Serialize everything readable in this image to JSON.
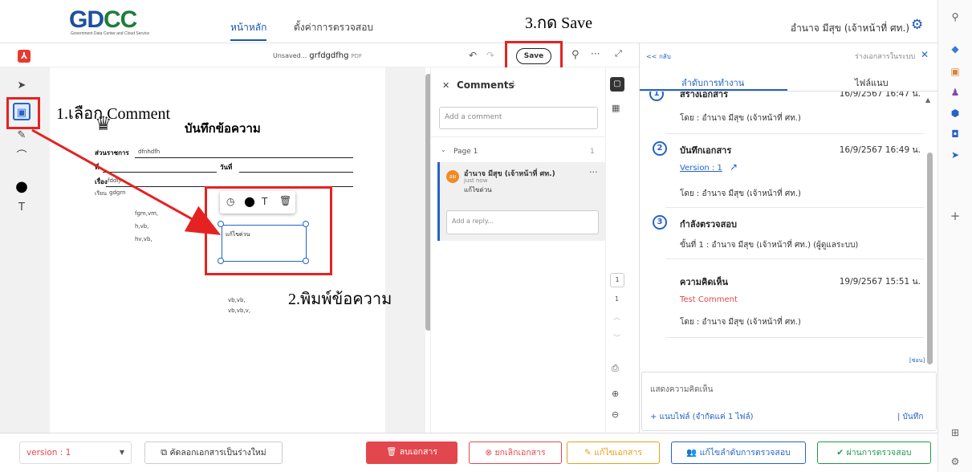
{
  "header": {
    "logo": "GDCC",
    "logo_sub": "Government Data Center and Cloud Service",
    "nav_home": "หน้าหลัก",
    "nav_settings": "ตั้งค่าการตรวจสอบ",
    "user": "อำนาจ มีสุข (เจ้าหน้าที่ ศท.)"
  },
  "annotations": {
    "step1": "1.เลือก Comment",
    "step2": "2.พิมพ์ข้อความ",
    "step3": "3.กด Save"
  },
  "pdf_toolbar": {
    "filename_prefix": "Unsaved...",
    "filename": "grfdgdfhg",
    "filetype": "PDF",
    "save_label": "Save"
  },
  "document": {
    "title": "บันทึกข้อความ",
    "label_agency": "ส่วนราชการ",
    "val_agency": "dfnhdfh",
    "label_no": "ที่",
    "label_date": "วันที่",
    "label_subject": "เรื่อง",
    "val_subject": "fddfjn",
    "salutation": "เรียน",
    "val_to": "gdgrn",
    "lines": [
      "fgm,vm,",
      "h,vb,",
      "hv,vb,"
    ],
    "sign1": "vb,vb,",
    "sign2": "vb,vb,v,",
    "note_text": "แก้ไขด่วน"
  },
  "comments": {
    "title": "Comments",
    "count": "1",
    "add_placeholder": "Add a comment",
    "page_label": "Page 1",
    "page_count": "1",
    "avatar": "อม",
    "author": "อำนาจ มีสุข (เจ้าหน้าที่ ศท.)",
    "time": "just now",
    "text": "แก้ไขด่วน",
    "reply_placeholder": "Add a reply..."
  },
  "pager": {
    "page": "1",
    "total": "1"
  },
  "right_panel": {
    "back_link": "<< กลับ",
    "draft_link": "ร่างเอกสารในระบบ",
    "tab_workflow": "ลำดับการทำงาน",
    "tab_attach": "ไฟล์แนบ",
    "steps": [
      {
        "num": "1",
        "title": "สร้างเอกสาร",
        "date": "16/9/2567 16:47 น.",
        "by": "โดย : อำนาจ มีสุข (เจ้าหน้าที่ ศท.)"
      },
      {
        "num": "2",
        "title": "บันทึกเอกสาร",
        "date": "16/9/2567 16:49 น.",
        "version": "Version : 1",
        "by": "โดย : อำนาจ มีสุข (เจ้าหน้าที่ ศท.)"
      },
      {
        "num": "3",
        "title": "กำลังตรวจสอบ",
        "detail": "ขั้นที่ 1 : อำนาจ มีสุข (เจ้าหน้าที่ ศท.) (ผู้ดูแลระบบ)"
      }
    ],
    "comment_title": "ความคิดเห็น",
    "comment_date": "19/9/2567 15:51 น.",
    "comment_text": "Test Comment",
    "comment_by": "โดย : อำนาจ มีสุข (เจ้าหน้าที่ ศท.)",
    "delete_link": "[ซ่อน]",
    "input_placeholder": "แสดงความคิดเห็น",
    "attach_label": "+ แนบไฟล์ (จำกัดแค่ 1 ไฟล์)",
    "save_link": "| บันทึก"
  },
  "bottom": {
    "version": "version : 1",
    "copy_btn": "คัดลอกเอกสารเป็นร่างใหม่",
    "delete_btn": "ลบเอกสาร",
    "cancel_btn": "ยกเลิกเอกสาร",
    "edit_btn": "แก้ไขเอกสาร",
    "edit_order_btn": "แก้ไขลำดับการตรวจสอบ",
    "approve_btn": "ผ่านการตรวจสอบ"
  },
  "colors": {
    "accent": "#2563c9",
    "annotation_red": "#e52222",
    "delete_red": "#e2474e",
    "approve_green": "#1f9a4a",
    "edit_yellow": "#e3a21a"
  }
}
